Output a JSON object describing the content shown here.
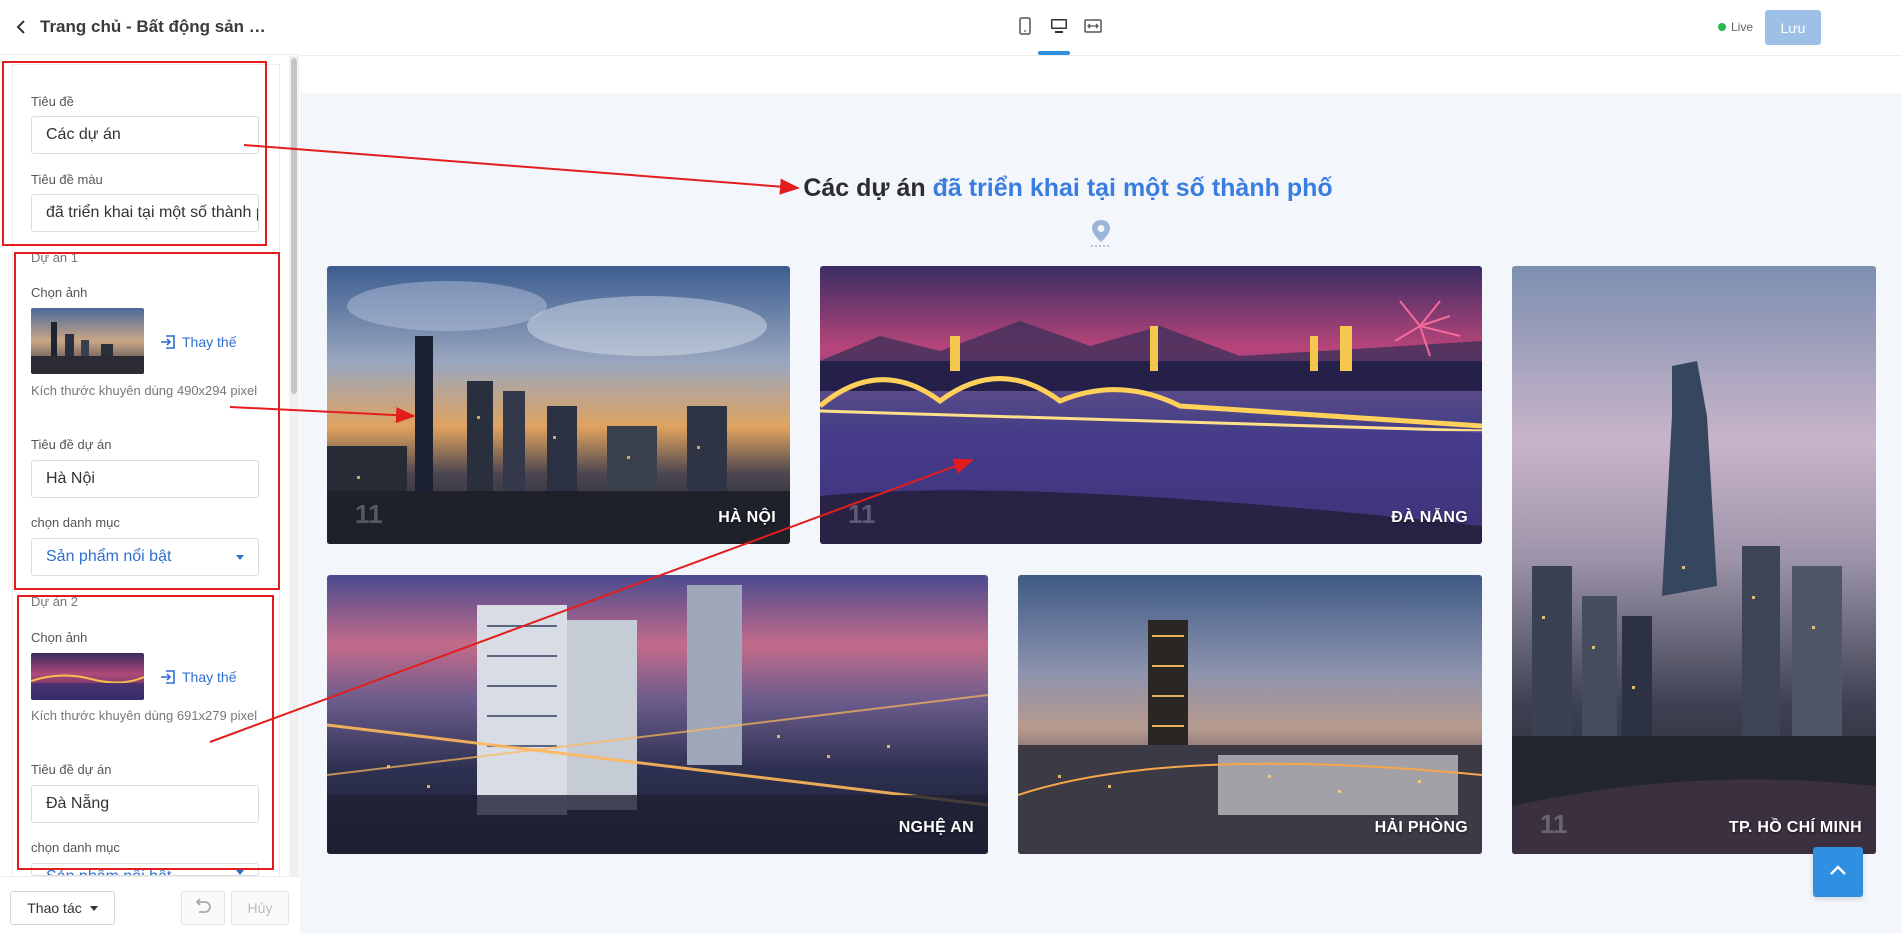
{
  "header": {
    "page_title": "Trang chủ - Bất động sản dự án",
    "live_label": "Live",
    "save_label": "Lưu"
  },
  "form": {
    "title_label": "Tiêu đề",
    "title_value": "Các dự án",
    "color_title_label": "Tiêu đề màu",
    "color_title_value": "đã triển khai tại một số thành phố",
    "projects": [
      {
        "group_label": "Dự án 1",
        "image_label": "Chọn ảnh",
        "replace_label": "Thay thế",
        "size_hint": "Kích thước khuyên dùng 490x294 pixel",
        "name_label": "Tiêu đề dự án",
        "name_value": "Hà Nội",
        "category_label": "chọn danh mục",
        "category_value": "Sản phẩm nổi bật"
      },
      {
        "group_label": "Dự án 2",
        "image_label": "Chọn ảnh",
        "replace_label": "Thay thế",
        "size_hint": "Kích thước khuyên dùng 691x279 pixel",
        "name_label": "Tiêu đề dự án",
        "name_value": "Đà Nẵng",
        "category_label": "chọn danh mục",
        "category_value": "Sản phẩm nổi bật"
      }
    ]
  },
  "footer": {
    "actions_label": "Thao tác",
    "cancel_label": "Hủy"
  },
  "preview": {
    "title_main": "Các dự án",
    "title_accent": "đã triển khai tại một số thành phố",
    "cards": [
      {
        "label": "HÀ NỘI",
        "num": "11"
      },
      {
        "label": "ĐÀ NẴNG",
        "num": "11"
      },
      {
        "label": "TP. HỒ CHÍ MINH",
        "num": "11"
      },
      {
        "label": "NGHỆ AN",
        "num": ""
      },
      {
        "label": "HẢI PHÒNG",
        "num": ""
      }
    ]
  },
  "colors": {
    "accent": "#3a7de0",
    "annotation_red": "#e31d1d",
    "live_green": "#2db84c",
    "save_button": "#9dc0e6"
  },
  "icons": [
    "chevron-left-icon",
    "mobile-icon",
    "desktop-icon",
    "fullwidth-icon",
    "replace-icon",
    "caret-down-icon",
    "undo-icon",
    "map-pin-icon",
    "arrow-up-icon"
  ]
}
